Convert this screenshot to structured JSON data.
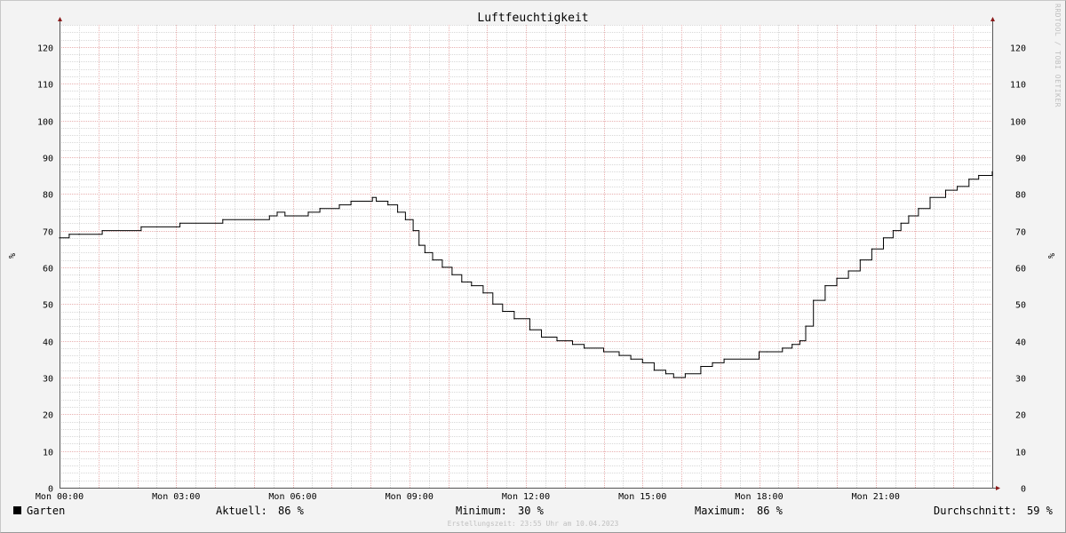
{
  "chart_data": {
    "type": "line",
    "title": "Luftfeuchtigkeit",
    "ylabel": "%",
    "ylim": [
      0,
      126
    ],
    "yticks": [
      0,
      10,
      20,
      30,
      40,
      50,
      60,
      70,
      80,
      90,
      100,
      110,
      120
    ],
    "xlim": [
      0,
      24
    ],
    "xticks": [
      {
        "hour": 0,
        "label": "Mon 00:00"
      },
      {
        "hour": 3,
        "label": "Mon 03:00"
      },
      {
        "hour": 6,
        "label": "Mon 06:00"
      },
      {
        "hour": 9,
        "label": "Mon 09:00"
      },
      {
        "hour": 12,
        "label": "Mon 12:00"
      },
      {
        "hour": 15,
        "label": "Mon 15:00"
      },
      {
        "hour": 18,
        "label": "Mon 18:00"
      },
      {
        "hour": 21,
        "label": "Mon 21:00"
      }
    ],
    "grid": true,
    "series": [
      {
        "name": "Garten",
        "color": "#000000",
        "x": [
          0,
          0.25,
          0.5,
          1.1,
          2.1,
          3.1,
          4.2,
          5.4,
          5.6,
          5.8,
          6.4,
          6.7,
          7.2,
          7.5,
          8.05,
          8.15,
          8.45,
          8.7,
          8.9,
          9.1,
          9.25,
          9.4,
          9.6,
          9.85,
          10.1,
          10.35,
          10.6,
          10.9,
          11.15,
          11.4,
          11.7,
          12.1,
          12.4,
          12.8,
          13.2,
          13.5,
          14.0,
          14.4,
          14.7,
          15.0,
          15.3,
          15.6,
          15.8,
          16.1,
          16.5,
          16.8,
          17.1,
          18.0,
          18.2,
          18.6,
          18.85,
          19.05,
          19.2,
          19.4,
          19.7,
          20.0,
          20.3,
          20.6,
          20.9,
          21.2,
          21.45,
          21.65,
          21.85,
          22.1,
          22.4,
          22.8,
          23.1,
          23.4,
          23.65,
          24.0
        ],
        "y": [
          68,
          69,
          69,
          70,
          71,
          72,
          73,
          74,
          75,
          74,
          75,
          76,
          77,
          78,
          79,
          78,
          77,
          75,
          73,
          70,
          66,
          64,
          62,
          60,
          58,
          56,
          55,
          53,
          50,
          48,
          46,
          43,
          41,
          40,
          39,
          38,
          37,
          36,
          35,
          34,
          32,
          31,
          30,
          31,
          33,
          34,
          35,
          37,
          37,
          38,
          39,
          40,
          44,
          51,
          55,
          57,
          59,
          62,
          65,
          68,
          70,
          72,
          74,
          76,
          79,
          81,
          82,
          84,
          85,
          86
        ]
      }
    ]
  },
  "legend": {
    "series_name": "Garten",
    "current_label": "Aktuell:",
    "current_value": "86 %",
    "min_label": "Minimum:",
    "min_value": "30 %",
    "max_label": "Maximum:",
    "max_value": "86 %",
    "avg_label": "Durchschnitt:",
    "avg_value": "59 %"
  },
  "footer": "Erstellungszeit: 23:55 Uhr am 10.04.2023",
  "watermark": "RRDTOOL / TOBI OETIKER"
}
